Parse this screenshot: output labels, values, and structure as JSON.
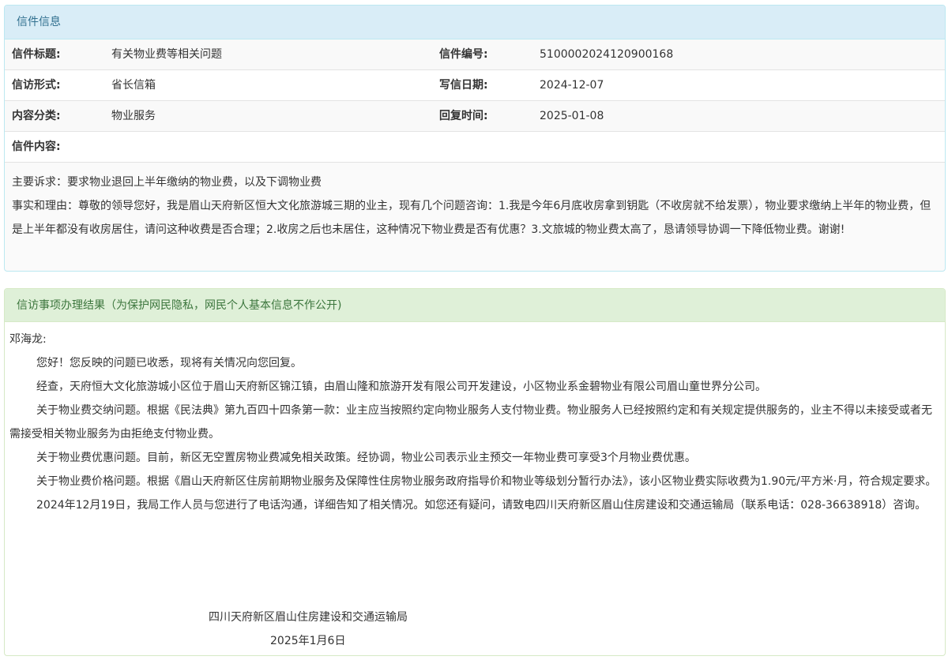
{
  "letter_info": {
    "heading": "信件信息",
    "rows": [
      {
        "label1": "信件标题:",
        "value1": "有关物业费等相关问题",
        "label2": "信件编号:",
        "value2": "5100002024120900168"
      },
      {
        "label1": "信访形式:",
        "value1": "省长信箱",
        "label2": "写信日期:",
        "value2": "2024-12-07"
      },
      {
        "label1": "内容分类:",
        "value1": "物业服务",
        "label2": "回复时间:",
        "value2": "2025-01-08"
      }
    ],
    "content_label": "信件内容:",
    "content": [
      "主要诉求：要求物业退回上半年缴纳的物业费，以及下调物业费",
      "事实和理由：尊敬的领导您好，我是眉山天府新区恒大文化旅游城三期的业主，现有几个问题咨询：1.我是今年6月底收房拿到钥匙（不收房就不给发票），物业要求缴纳上半年的物业费，但是上半年都没有收房居住，请问这种收费是否合理；2.收房之后也未居住，这种情况下物业费是否有优惠？3.文旅城的物业费太高了，恳请领导协调一下降低物业费。谢谢!"
    ]
  },
  "reply": {
    "heading": "信访事项办理结果（为保护网民隐私，网民个人基本信息不作公开)",
    "salutation": "邓海龙:",
    "paragraphs": [
      "您好！您反映的问题已收悉，现将有关情况向您回复。",
      "经查，天府恒大文化旅游城小区位于眉山天府新区锦江镇，由眉山隆和旅游开发有限公司开发建设，小区物业系金碧物业有限公司眉山童世界分公司。",
      "关于物业费交纳问题。根据《民法典》第九百四十四条第一款：业主应当按照约定向物业服务人支付物业费。物业服务人已经按照约定和有关规定提供服务的，业主不得以未接受或者无需接受相关物业服务为由拒绝支付物业费。",
      "关于物业费优惠问题。目前，新区无空置房物业费减免相关政策。经协调，物业公司表示业主预交一年物业费可享受3个月物业费优惠。",
      "关于物业费价格问题。根据《眉山天府新区住房前期物业服务及保障性住房物业服务政府指导价和物业等级划分暂行办法》，该小区物业费实际收费为1.90元/平方米·月，符合规定要求。",
      "2024年12月19日，我局工作人员与您进行了电话沟通，详细告知了相关情况。如您还有疑问，请致电四川天府新区眉山住房建设和交通运输局（联系电话：028-36638918）咨询。"
    ],
    "signature_org": "四川天府新区眉山住房建设和交通运输局",
    "signature_date": "2025年1月6日"
  }
}
